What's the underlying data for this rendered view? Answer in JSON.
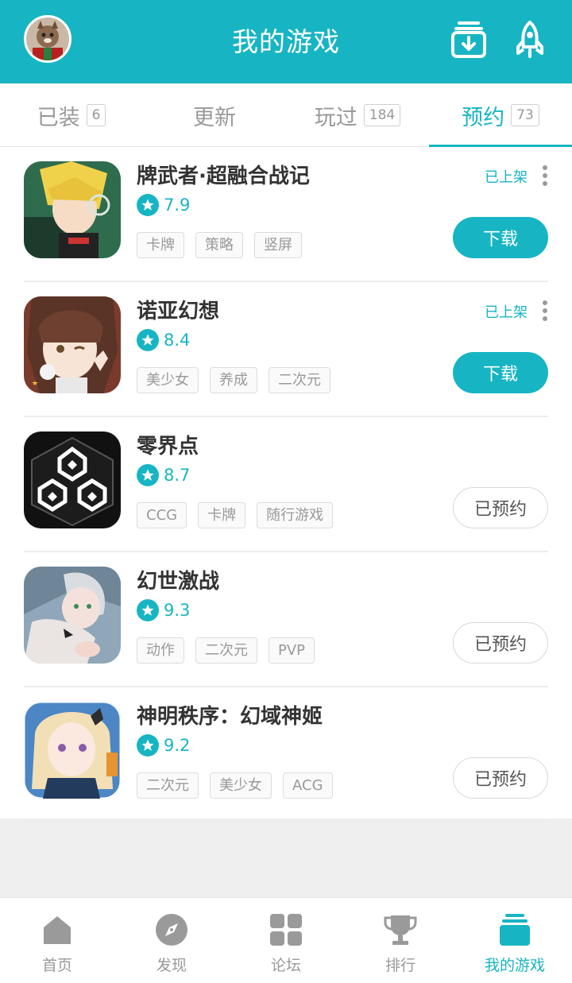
{
  "header": {
    "title": "我的游戏",
    "avatar_icon": "user-avatar",
    "download_icon": "download-manager-icon",
    "rocket_icon": "rocket-icon"
  },
  "tabs": [
    {
      "label": "已装",
      "badge": "6"
    },
    {
      "label": "更新",
      "badge": ""
    },
    {
      "label": "玩过",
      "badge": "184"
    },
    {
      "label": "预约",
      "badge": "73",
      "active": true
    }
  ],
  "games": [
    {
      "name": "牌武者·超融合战记",
      "rating": "7.9",
      "tags": [
        "卡牌",
        "策略",
        "竖屏"
      ],
      "status": "已上架",
      "action": "下载"
    },
    {
      "name": "诺亚幻想",
      "rating": "8.4",
      "tags": [
        "美少女",
        "养成",
        "二次元"
      ],
      "status": "已上架",
      "action": "下载"
    },
    {
      "name": "零界点",
      "rating": "8.7",
      "tags": [
        "CCG",
        "卡牌",
        "随行游戏"
      ],
      "status": "",
      "action": "已预约"
    },
    {
      "name": "幻世激战",
      "rating": "9.3",
      "tags": [
        "动作",
        "二次元",
        "PVP"
      ],
      "status": "",
      "action": "已预约"
    },
    {
      "name": "神明秩序：幻域神姬",
      "rating": "9.2",
      "tags": [
        "二次元",
        "美少女",
        "ACG"
      ],
      "status": "",
      "action": "已预约"
    }
  ],
  "bottom_nav": [
    {
      "label": "首页",
      "icon": "home-icon"
    },
    {
      "label": "发现",
      "icon": "compass-icon"
    },
    {
      "label": "论坛",
      "icon": "grid-icon"
    },
    {
      "label": "排行",
      "icon": "trophy-icon"
    },
    {
      "label": "我的游戏",
      "icon": "my-games-icon",
      "active": true
    }
  ],
  "colors": {
    "accent": "#17b5c3",
    "muted": "#999999"
  }
}
